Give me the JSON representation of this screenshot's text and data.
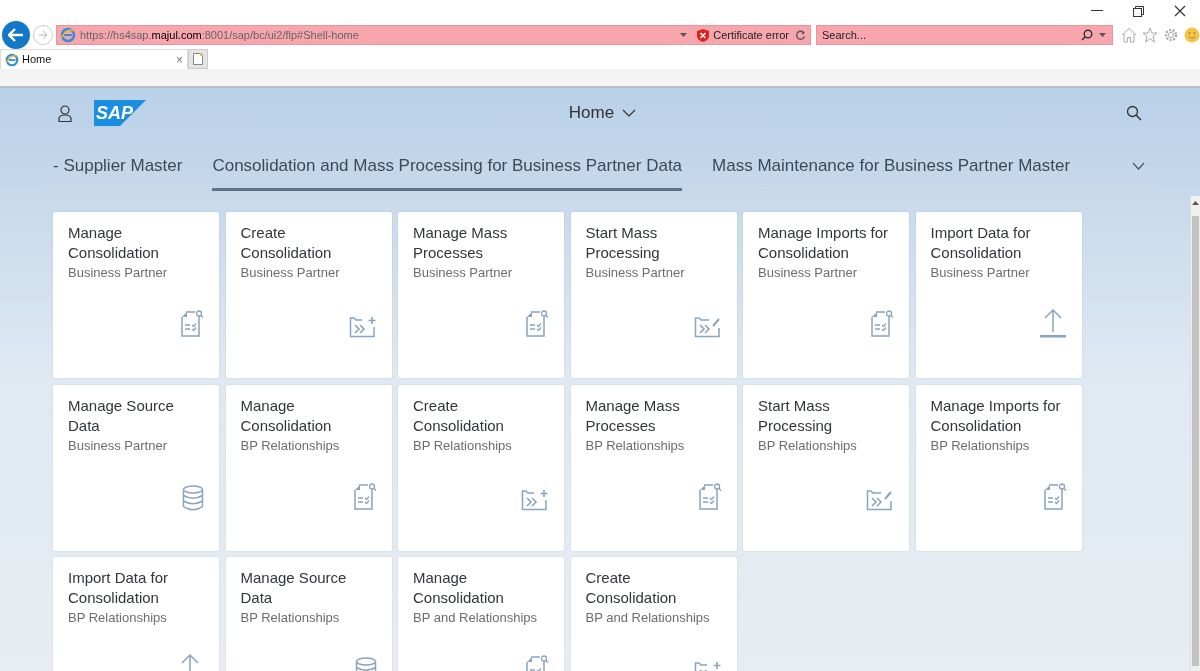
{
  "browser": {
    "url": "https://hs4sap.**majul.com**:8001/sap/bc/ui2/flp#Shell-home",
    "certificate_warning": "Certificate error",
    "search": {
      "placeholder": "Search..."
    },
    "tabs": [
      {
        "label": "Home",
        "close": "×",
        "selected": true
      }
    ]
  },
  "shell": {
    "logo": "SAP",
    "title": "Home"
  },
  "groups": [
    {
      "label": "- Supplier Master",
      "selected": false
    },
    {
      "label": "Consolidation and Mass Processing for Business Partner Data",
      "selected": true
    },
    {
      "label": "Mass Maintenance for Business Partner Master",
      "selected": false
    }
  ],
  "tiles": [
    {
      "title": "Manage Consolidation",
      "subtitle": "Business Partner",
      "kind": "report"
    },
    {
      "title": "Create Consolidation",
      "subtitle": "Business Partner",
      "kind": "create"
    },
    {
      "title": "Manage Mass Processes",
      "subtitle": "Business Partner",
      "kind": "report"
    },
    {
      "title": "Start Mass Processing",
      "subtitle": "Business Partner",
      "kind": "process"
    },
    {
      "title": "Manage Imports for Consolidation",
      "subtitle": "Business Partner",
      "kind": "report"
    },
    {
      "title": "Import Data for Consolidation",
      "subtitle": "Business Partner",
      "kind": "upload"
    },
    {
      "title": "Manage Source Data",
      "subtitle": "Business Partner",
      "kind": "database"
    },
    {
      "title": "Manage Consolidation",
      "subtitle": "BP Relationships",
      "kind": "report"
    },
    {
      "title": "Create Consolidation",
      "subtitle": "BP Relationships",
      "kind": "create"
    },
    {
      "title": "Manage Mass Processes",
      "subtitle": "BP Relationships",
      "kind": "report"
    },
    {
      "title": "Start Mass Processing",
      "subtitle": "BP Relationships",
      "kind": "process"
    },
    {
      "title": "Manage Imports for Consolidation",
      "subtitle": "BP Relationships",
      "kind": "report"
    },
    {
      "title": "Import Data for Consolidation",
      "subtitle": "BP Relationships",
      "kind": "upload"
    },
    {
      "title": "Manage Source Data",
      "subtitle": "BP Relationships",
      "kind": "database"
    },
    {
      "title": "Manage Consolidation",
      "subtitle": "BP and Relationships",
      "kind": "report"
    },
    {
      "title": "Create Consolidation",
      "subtitle": "BP and Relationships",
      "kind": "create"
    }
  ]
}
